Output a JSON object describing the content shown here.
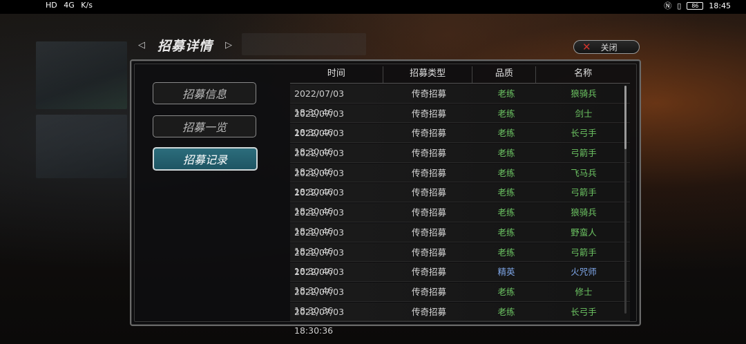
{
  "status_bar": {
    "left_items": [
      "HD",
      "4G",
      "K/s"
    ],
    "time": "18:45",
    "battery": "86"
  },
  "header": {
    "title": "招募详情",
    "close_label": "关闭"
  },
  "tabs": [
    {
      "label": "招募信息",
      "active": false
    },
    {
      "label": "招募一览",
      "active": false
    },
    {
      "label": "招募记录",
      "active": true
    }
  ],
  "table": {
    "columns": [
      "时间",
      "招募类型",
      "品质",
      "名称"
    ],
    "rows": [
      {
        "time": "2022/07/03 18:30:46",
        "type": "传奇招募",
        "quality": "老练",
        "name": "狼骑兵",
        "color": "green"
      },
      {
        "time": "2022/07/03 18:30:46",
        "type": "传奇招募",
        "quality": "老练",
        "name": "剑士",
        "color": "green"
      },
      {
        "time": "2022/07/03 18:30:46",
        "type": "传奇招募",
        "quality": "老练",
        "name": "长弓手",
        "color": "green"
      },
      {
        "time": "2022/07/03 18:30:46",
        "type": "传奇招募",
        "quality": "老练",
        "name": "弓箭手",
        "color": "green"
      },
      {
        "time": "2022/07/03 18:30:46",
        "type": "传奇招募",
        "quality": "老练",
        "name": "飞马兵",
        "color": "green"
      },
      {
        "time": "2022/07/03 18:30:46",
        "type": "传奇招募",
        "quality": "老练",
        "name": "弓箭手",
        "color": "green"
      },
      {
        "time": "2022/07/03 18:30:46",
        "type": "传奇招募",
        "quality": "老练",
        "name": "狼骑兵",
        "color": "green"
      },
      {
        "time": "2022/07/03 18:30:46",
        "type": "传奇招募",
        "quality": "老练",
        "name": "野蛮人",
        "color": "green"
      },
      {
        "time": "2022/07/03 18:30:46",
        "type": "传奇招募",
        "quality": "老练",
        "name": "弓箭手",
        "color": "green"
      },
      {
        "time": "2022/07/03 18:30:46",
        "type": "传奇招募",
        "quality": "精英",
        "name": "火咒师",
        "color": "blue"
      },
      {
        "time": "2022/07/03 18:30:36",
        "type": "传奇招募",
        "quality": "老练",
        "name": "修士",
        "color": "green"
      },
      {
        "time": "2022/07/03 18:30:36",
        "type": "传奇招募",
        "quality": "老练",
        "name": "长弓手",
        "color": "green"
      }
    ]
  },
  "colors": {
    "green": "#6cc462",
    "blue": "#7ea6e8",
    "active_tab": "#2c6d7c",
    "close_x": "#d0342c"
  }
}
